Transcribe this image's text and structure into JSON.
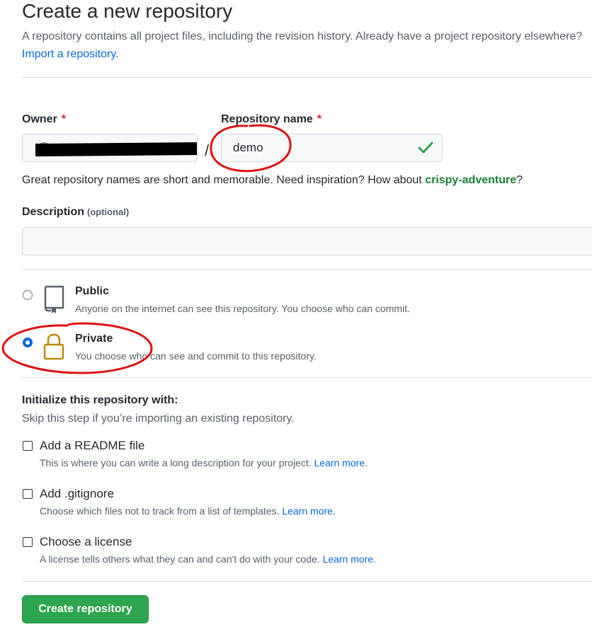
{
  "header": {
    "title": "Create a new repository",
    "subtitle": "A repository contains all project files, including the revision history. Already have a project repository elsewhere?",
    "import_link": "Import a repository."
  },
  "owner": {
    "label": "Owner",
    "required_mark": "*"
  },
  "separator": "/",
  "repo_name": {
    "label": "Repository name",
    "required_mark": "*",
    "value": "demo"
  },
  "hint": {
    "text": "Great repository names are short and memorable. Need inspiration? How about ",
    "suggestion": "crispy-adventure",
    "end": "?"
  },
  "description": {
    "label": "Description",
    "optional": "(optional)",
    "value": ""
  },
  "visibility": {
    "public": {
      "title": "Public",
      "subtitle": "Anyone on the internet can see this repository. You choose who can commit."
    },
    "private": {
      "title": "Private",
      "subtitle": "You choose who can see and commit to this repository."
    },
    "selected": "private"
  },
  "init": {
    "heading": "Initialize this repository with:",
    "subtitle": "Skip this step if you’re importing an existing repository.",
    "readme": {
      "label": "Add a README file",
      "description": "This is where you can write a long description for your project.",
      "learn_more": "Learn more."
    },
    "gitignore": {
      "label": "Add .gitignore",
      "description": "Choose which files not to track from a list of templates.",
      "learn_more": "Learn more."
    },
    "license": {
      "label": "Choose a license",
      "description": "A license tells others what they can and can't do with your code.",
      "learn_more": "Learn more."
    }
  },
  "submit": {
    "label": "Create repository"
  },
  "colors": {
    "primary_button": "#2da44e",
    "link": "#0969da",
    "suggestion": "#1a7f37",
    "required": "#cf222e",
    "annotation": "#e01010",
    "lock": "#bf8700"
  },
  "icons": {
    "public": "repo-icon",
    "private": "lock-icon",
    "valid": "check-icon"
  }
}
